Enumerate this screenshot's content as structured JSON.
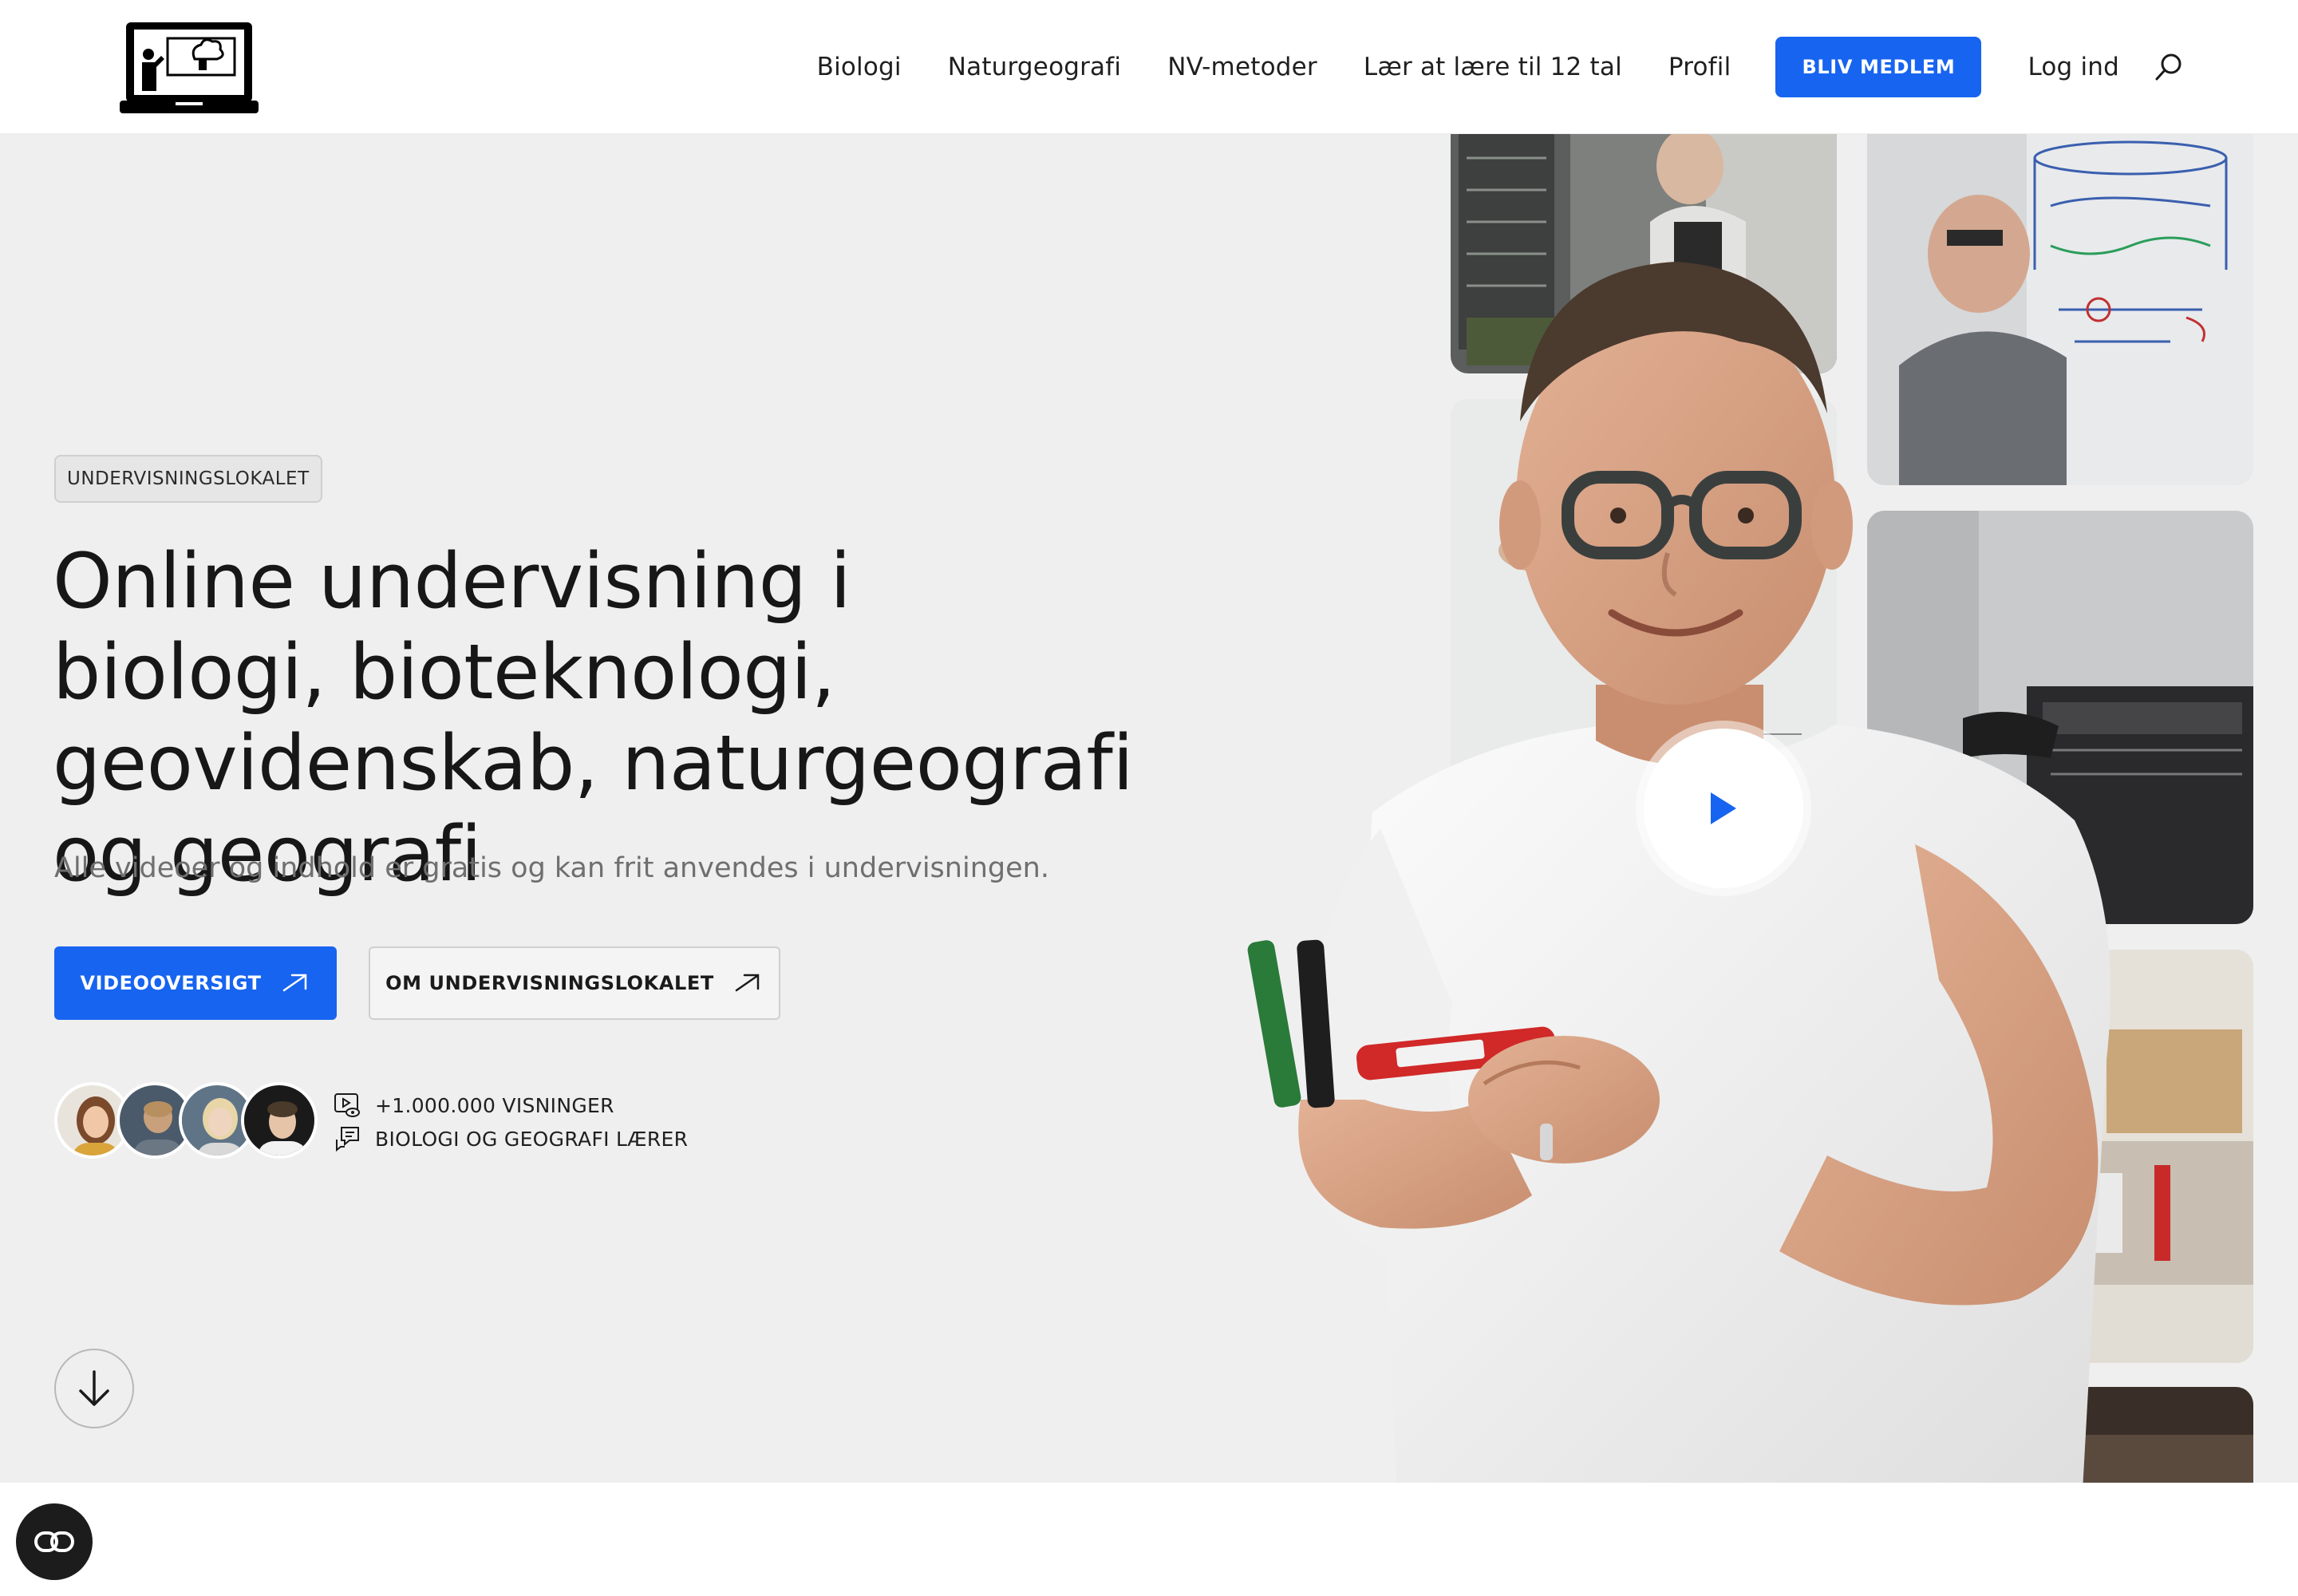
{
  "header": {
    "nav": [
      "Biologi",
      "Naturgeografi",
      "NV-metoder",
      "Lær at lære til 12 tal",
      "Profil"
    ],
    "join_label": "BLIV MEDLEM",
    "login_label": "Log ind"
  },
  "hero": {
    "badge": "UNDERVISNINGSLOKALET",
    "headline": "Online undervisning i biologi, bioteknologi, geovidenskab, naturgeografi og geografi",
    "subtitle": "Alle videoer og indhold er gratis og kan frit anvendes i undervisningen.",
    "primary_button": "VIDEOOVERSIGT",
    "secondary_button": "OM UNDERVISNINGSLOKALET",
    "stats": {
      "views": "+1.000.000 VISNINGER",
      "teacher": "BIOLOGI OG GEOGRAFI LÆRER"
    }
  },
  "colors": {
    "accent": "#1764f0",
    "hero_bg": "#efefef"
  },
  "icons": [
    "logo-teacher-laptop-icon",
    "search-icon",
    "arrow-right-icon",
    "play-icon",
    "video-views-icon",
    "chat-bubble-icon",
    "arrow-down-icon",
    "accessibility-icon"
  ]
}
